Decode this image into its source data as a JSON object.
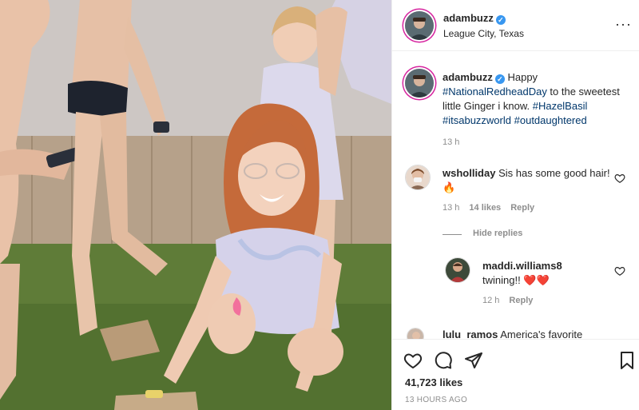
{
  "post": {
    "author": "adambuzz",
    "location": "League City, Texas",
    "more_icon": "more-dots-icon"
  },
  "caption": {
    "author": "adambuzz",
    "text_before": "Happy ",
    "tag1": "#NationalRedheadDay",
    "text_mid": " to the sweetest little Ginger i know. ",
    "tag2": "#HazelBasil",
    "tag3": "#itsabuzzworld",
    "tag4": "#outdaughtered",
    "time": "13 h"
  },
  "comments": [
    {
      "author": "wsholliday",
      "text": "Sis has some good hair! 🔥",
      "time": "13 h",
      "likes": "14 likes",
      "reply": "Reply"
    },
    {
      "author": "maddi.williams8",
      "text": "twining!! ❤️❤️",
      "time": "12 h",
      "reply": "Reply"
    },
    {
      "author": "lulu_ramos",
      "text": "America's favorite"
    }
  ],
  "hide_replies": "Hide replies",
  "likes_count": "41,723 likes",
  "posted_ago": "13 HOURS AGO",
  "colors": {
    "accent": "#3897f0",
    "link": "#00376b",
    "muted": "#8e8e8e",
    "like": "#ed4956"
  }
}
